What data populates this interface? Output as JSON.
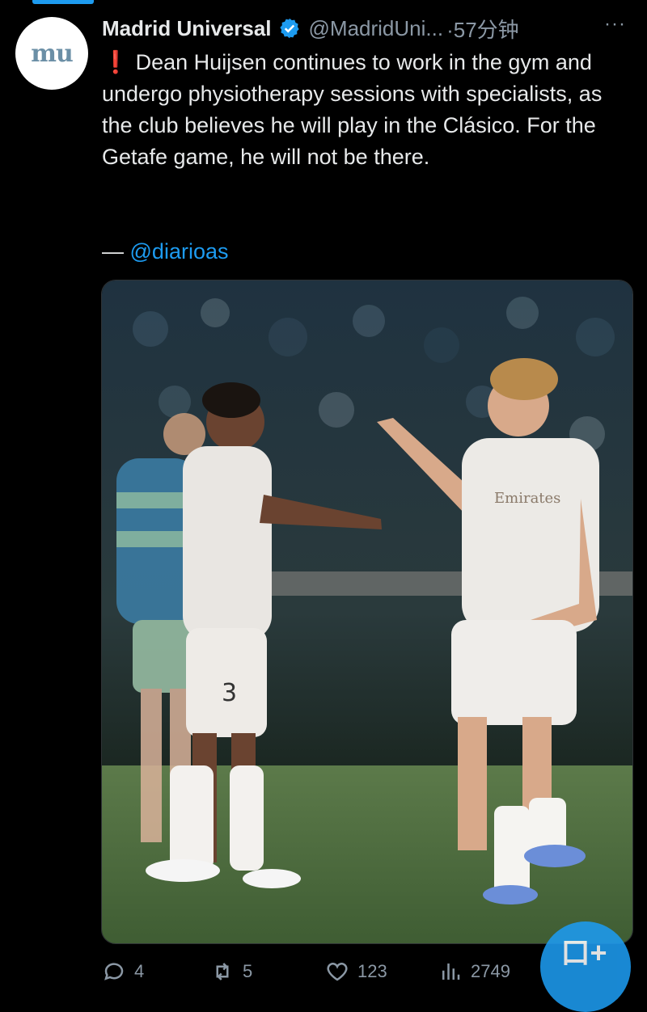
{
  "tweet": {
    "author_name": "Madrid Universal",
    "author_handle": "@MadridUni...",
    "time": "·57分钟",
    "more": "···",
    "avatar_text": "mu",
    "alert_glyph": "❗",
    "text": "Dean Huijsen continues to work in the gym and undergo physiotherapy sessions with specialists, as the club believes he will play in the Clásico. For the Getafe game, he will not be there.",
    "credit_dash": "— ",
    "credit_mention": "@diarioas",
    "media_icon": "photo-football-players-handshake"
  },
  "actions": {
    "reply_count": "4",
    "retweet_count": "5",
    "like_count": "123",
    "views_count": "2749"
  },
  "fab": {
    "glyph": "口+"
  },
  "colors": {
    "accent": "#1d9bf0",
    "alert": "#f4212e",
    "muted": "#8b98a5",
    "text": "#e7e9ea",
    "background": "#000000"
  }
}
